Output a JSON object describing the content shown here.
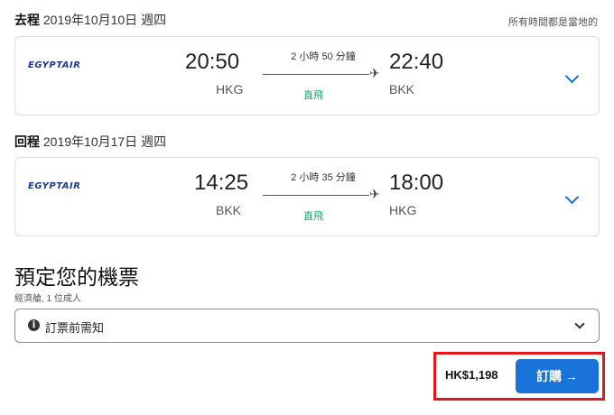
{
  "header": {
    "timezone_note": "所有時間都是當地的"
  },
  "outbound": {
    "label": "去程",
    "date": "2019年10月10日 週四",
    "airline": "EGYPTAIR",
    "depart_time": "20:50",
    "depart_airport": "HKG",
    "duration": "2 小時 50 分鐘",
    "arrive_time": "22:40",
    "arrive_airport": "BKK",
    "stops": "直飛",
    "plane_glyph": "✈"
  },
  "return": {
    "label": "回程",
    "date": "2019年10月17日 週四",
    "airline": "EGYPTAIR",
    "depart_time": "14:25",
    "depart_airport": "BKK",
    "duration": "2 小時 35 分鐘",
    "arrive_time": "18:00",
    "arrive_airport": "HKG",
    "stops": "直飛",
    "plane_glyph": "✈"
  },
  "booking": {
    "title": "預定您的機票",
    "subtitle": "經濟艙, 1 位成人",
    "notice_label": "訂票前需知",
    "info_glyph": "i",
    "price": "HK$1,198",
    "book_label": "訂購 →"
  },
  "colors": {
    "accent_blue": "#1a73d9",
    "nonstop_green": "#22a06b",
    "highlight_red": "#e0191e",
    "airline_navy": "#1a3a8c"
  }
}
